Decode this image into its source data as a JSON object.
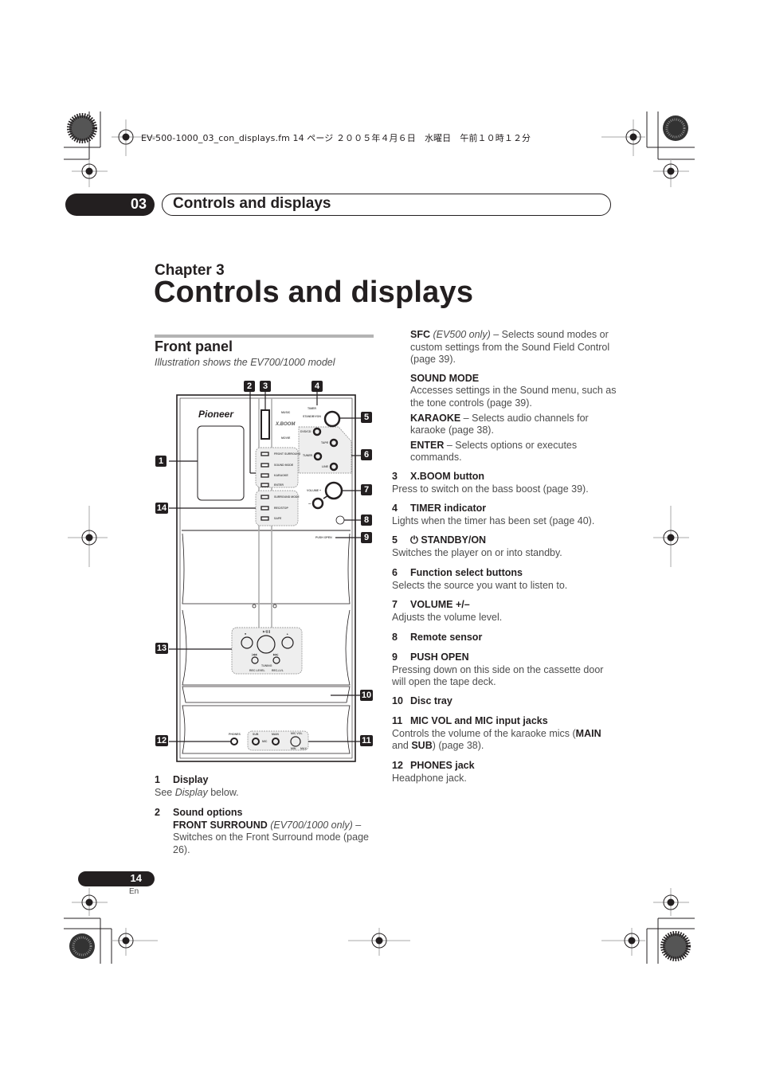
{
  "print_header": "EV-500-1000_03_con_displays.fm  14 ページ  ２００５年４月６日　水曜日　午前１０時１２分",
  "chapter_tab": {
    "number": "03",
    "title": "Controls and displays"
  },
  "chapter_label": "Chapter 3",
  "page_title": "Controls and displays",
  "section": {
    "title": "Front panel",
    "subtitle": "Illustration shows the EV700/1000 model"
  },
  "illustration": {
    "brand": "Pioneer",
    "callouts": [
      "1",
      "2",
      "3",
      "4",
      "5",
      "6",
      "7",
      "8",
      "9",
      "10",
      "11",
      "12",
      "13",
      "14"
    ],
    "labels": {
      "music": "MUSIC",
      "movie": "MOVIE",
      "xboom": "X.BOOM",
      "timer": "TIMER",
      "standby": "STANDBY/ON",
      "dvd_cd": "DVD/CD",
      "tape": "TAPE",
      "tuner": "TUNER",
      "line": "LINE",
      "volume": "VOLUME +",
      "volume_minus": "–",
      "push_open": "PUSH OPEN",
      "sound_buttons": [
        "FRONT SURROUND",
        "SOUND MODE",
        "KARAOKE",
        "ENTER"
      ],
      "setup_buttons": [
        "SURROUND MODE",
        "REC/STOP",
        "SAFE"
      ],
      "stop": "■",
      "play_pause": "▶/❚❚",
      "eject": "▲",
      "prev": "|◀◀",
      "next": "▶▶|",
      "tuning": "TUNING",
      "rec_level": "REC LEVEL",
      "rec_lvl2": "REC-LVL",
      "phones": "PHONES",
      "sub": "SUB",
      "main": "MAIN",
      "mic": "MIC",
      "mic_vol": "MIC VOL",
      "min": "MIN",
      "max": "MAX"
    }
  },
  "left_items": [
    {
      "num": "1",
      "title": "Display",
      "body_pre": "See ",
      "body_italic": "Display",
      "body_post": " below."
    },
    {
      "num": "2",
      "title": "Sound options",
      "sub_bold": "FRONT SURROUND",
      "sub_italic": " (EV700/1000 only)",
      "sub_rest": " – Switches on the Front Surround mode (page 26)."
    }
  ],
  "right_top": [
    {
      "bold": "SFC",
      "italic": " (EV500 only)",
      "rest": " – Selects sound modes or custom settings from the Sound Field Control (page 39)."
    },
    {
      "bold": "SOUND MODE",
      "rest": "Accesses settings in the Sound menu, such as the tone controls (page 39)."
    },
    {
      "bold": "KARAOKE",
      "rest": " – Selects audio channels for karaoke (page 38)."
    },
    {
      "bold": "ENTER",
      "rest": " – Selects options or executes commands."
    }
  ],
  "right_items": [
    {
      "num": "3",
      "title": "X.BOOM button",
      "body": "Press to switch on the bass boost (page 39)."
    },
    {
      "num": "4",
      "title": "TIMER indicator",
      "body": "Lights when the timer has been set (page 40)."
    },
    {
      "num": "5",
      "title": "⏻ STANDBY/ON",
      "body": "Switches the player on or into standby."
    },
    {
      "num": "6",
      "title": "Function select buttons",
      "body": "Selects the source you want to listen to."
    },
    {
      "num": "7",
      "title": "VOLUME +/–",
      "body": "Adjusts the volume level."
    },
    {
      "num": "8",
      "title": "Remote sensor",
      "body": ""
    },
    {
      "num": "9",
      "title": "PUSH OPEN",
      "body": "Pressing down on this side on the cassette door will open the tape deck."
    },
    {
      "num": "10",
      "title": "Disc tray",
      "body": ""
    },
    {
      "num": "11",
      "title": "MIC VOL and MIC input jacks",
      "body_pre": "Controls the volume of the karaoke mics (",
      "b1": "MAIN",
      "mid": " and ",
      "b2": "SUB",
      "post": ") (page 38)."
    },
    {
      "num": "12",
      "title": "PHONES jack",
      "body": "Headphone jack."
    }
  ],
  "page_number": "14",
  "language": "En"
}
